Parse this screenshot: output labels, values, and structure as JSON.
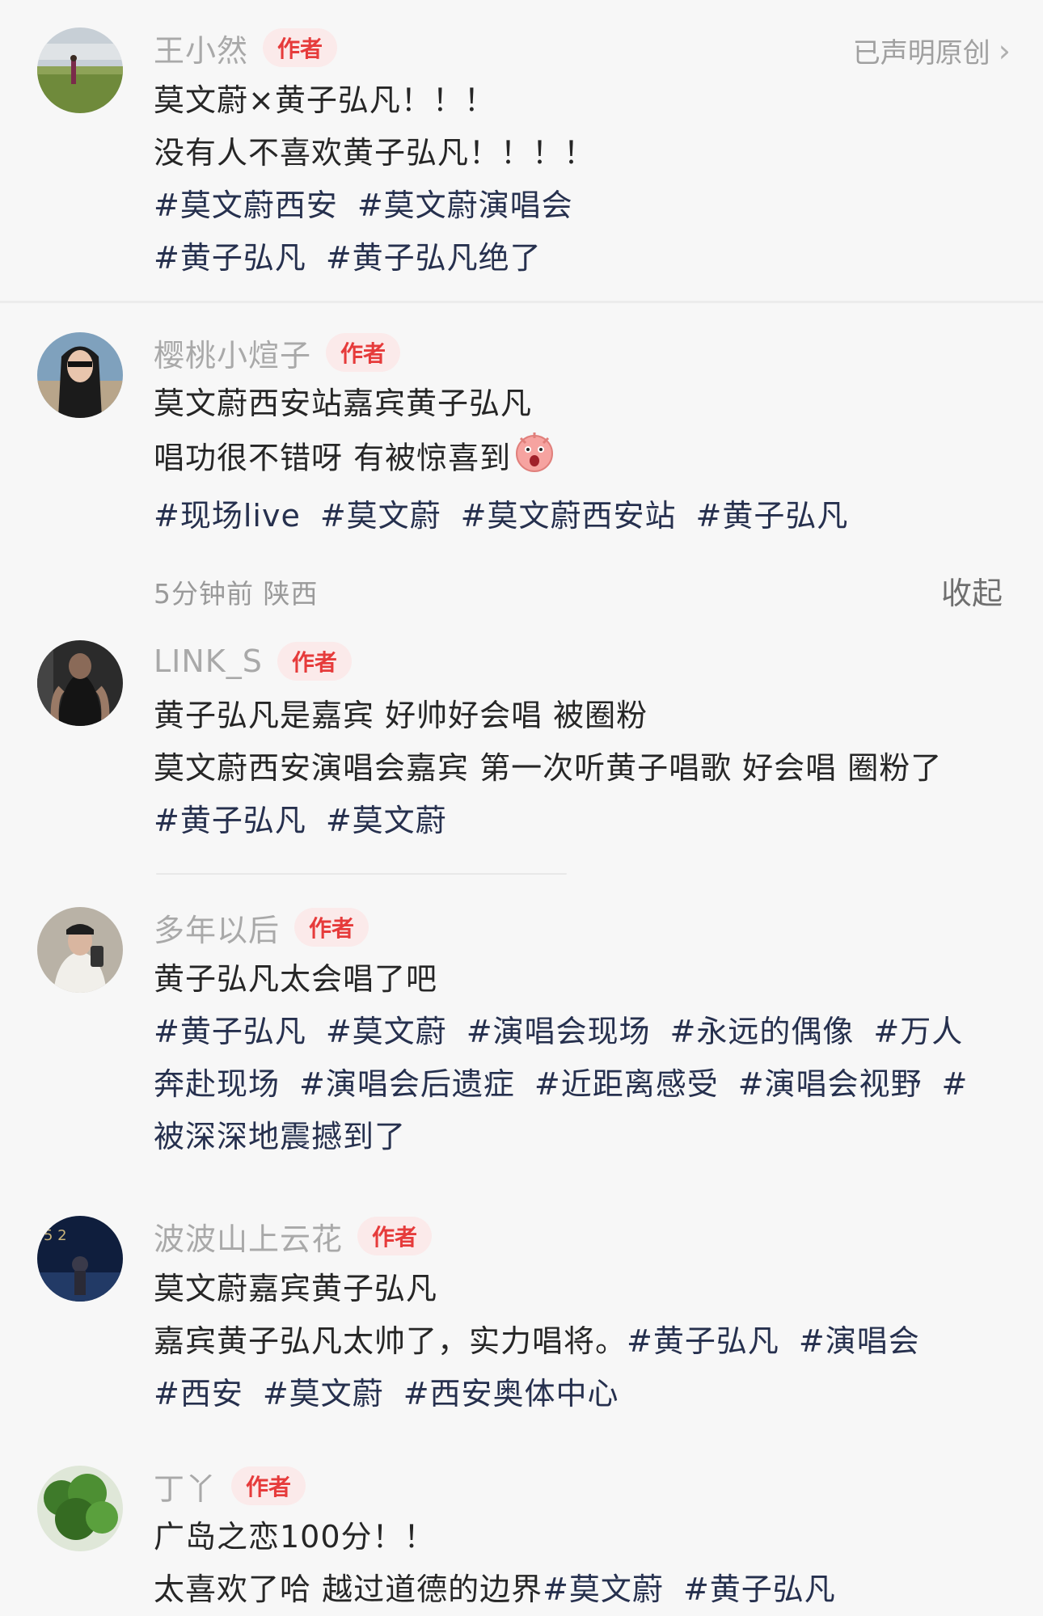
{
  "posts": [
    {
      "username": "王小然",
      "badge": "作者",
      "original_label": "已声明原创",
      "lines": [
        "莫文蔚×黄子弘凡！！！",
        "没有人不喜欢黄子弘凡！！！！"
      ],
      "tag_lines": [
        [
          "#莫文蔚西安",
          "#莫文蔚演唱会"
        ],
        [
          "#黄子弘凡",
          "#黄子弘凡绝了"
        ]
      ]
    },
    {
      "username": "樱桃小煊子",
      "badge": "作者",
      "lines": [
        "莫文蔚西安站嘉宾黄子弘凡",
        "唱功很不错呀 有被惊喜到"
      ],
      "tag_lines": [
        [
          "#现场live",
          "#莫文蔚",
          "#莫文蔚西安站",
          "#黄子弘凡"
        ]
      ],
      "meta": "5分钟前 陕西",
      "collapse_label": "收起"
    },
    {
      "username": "LINK_S",
      "badge": "作者",
      "lines": [
        "黄子弘凡是嘉宾 好帅好会唱 被圈粉",
        "莫文蔚西安演唱会嘉宾 第一次听黄子唱歌 好会唱 圈粉了"
      ],
      "tag_lines": [
        [
          "#黄子弘凡",
          "#莫文蔚"
        ]
      ]
    },
    {
      "username": "多年以后",
      "badge": "作者",
      "lines": [
        "黄子弘凡太会唱了吧"
      ],
      "tag_lines": [
        [
          "#黄子弘凡",
          "#莫文蔚",
          "#演唱会现场",
          "#永远的偶像",
          "#万人"
        ],
        [
          "奔赴现场",
          "#演唱会后遗症",
          "#近距离感受",
          "#演唱会视野",
          "#"
        ],
        [
          "被深深地震撼到了"
        ]
      ]
    },
    {
      "username": "波波山上云花",
      "badge": "作者",
      "lines": [
        "莫文蔚嘉宾黄子弘凡"
      ],
      "mixed_line": {
        "text": "嘉宾黄子弘凡太帅了，实力唱将。",
        "tags": [
          "#黄子弘凡",
          "#演唱会"
        ]
      },
      "tag_lines": [
        [
          "#西安",
          "#莫文蔚",
          "#西安奥体中心"
        ]
      ]
    },
    {
      "username": "丁丫",
      "badge": "作者",
      "lines": [
        "广岛之恋100分！！"
      ],
      "mixed_line": {
        "text": "太喜欢了哈 越过道德的边界",
        "tags": [
          "#莫文蔚",
          "#黄子弘凡"
        ]
      }
    }
  ],
  "colors": {
    "tag": "#26304e",
    "badge_text": "#e63b3b",
    "badge_bg": "#fbeaea",
    "username": "#a9a9a9"
  },
  "icons": [
    "chevron-right-icon",
    "surprised-emoji-icon"
  ]
}
